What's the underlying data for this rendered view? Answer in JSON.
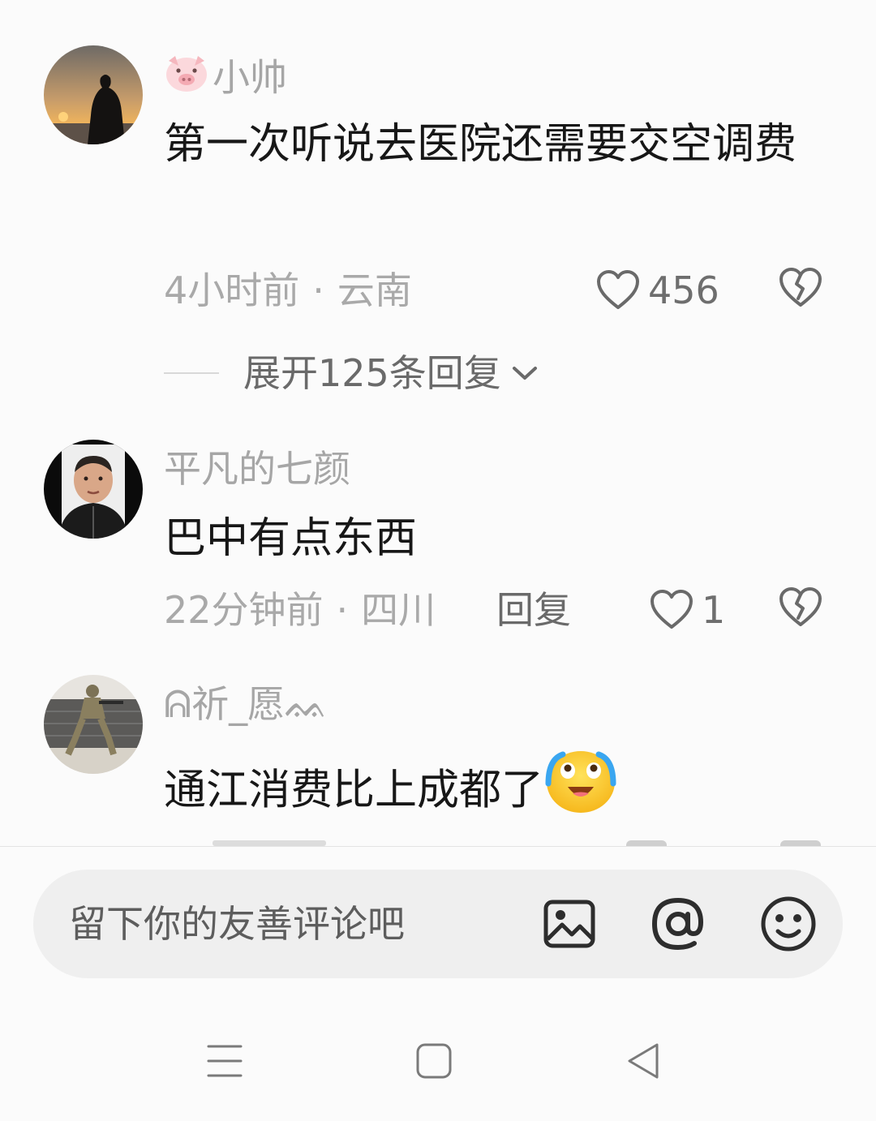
{
  "comments": [
    {
      "username": "小帅",
      "username_prefix_icon": "pig-emoji",
      "text": "第一次听说去医院还需要交空调费",
      "time": "4小时前",
      "location": "云南",
      "likes": "456",
      "expand_replies": "展开125条回复"
    },
    {
      "username": "平凡的七颜",
      "text": "巴中有点东西",
      "time": "22分钟前",
      "location": "四川",
      "reply_label": "回复",
      "likes": "1"
    },
    {
      "username": "ᕱ祈_愿ᨐ",
      "text": "通江消费比上成都了",
      "text_suffix_icon": "crying-emoji"
    }
  ],
  "meta_separator": "·",
  "input": {
    "placeholder": "留下你的友善评论吧",
    "icons": [
      "image-icon",
      "at-icon",
      "emoji-icon"
    ]
  },
  "navbar": {
    "icons": [
      "menu-icon",
      "home-square-icon",
      "back-triangle-icon"
    ]
  }
}
